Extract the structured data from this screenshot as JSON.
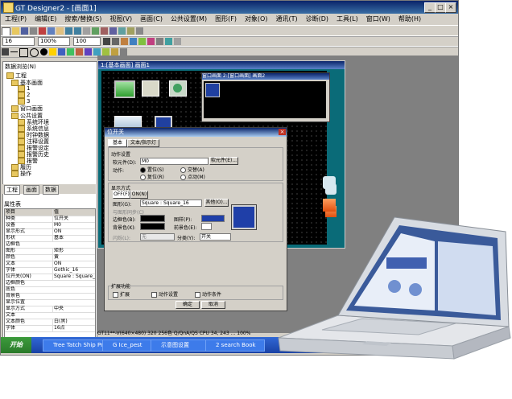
{
  "window": {
    "title": "GT Designer2 - [画面1]"
  },
  "menu": [
    "工程(P)",
    "编辑(E)",
    "搜索/替换(S)",
    "视图(V)",
    "画面(C)",
    "公共设置(M)",
    "图形(F)",
    "对象(O)",
    "通讯(T)",
    "诊断(D)",
    "工具(L)",
    "窗口(W)",
    "帮助(H)"
  ],
  "toolbar": {
    "font_combo": "16",
    "size_combo": "100%",
    "zoom_combo": "100"
  },
  "left_panel": {
    "title": "数据浏览(N)",
    "tree": [
      "工程",
      "基本画面",
      "1",
      "2",
      "3",
      "窗口画面",
      "公共设置",
      "系统环境",
      "系统信息",
      "时钟数据",
      "注释设置",
      "报警设定",
      "报警历史",
      "报警",
      "履历",
      "操作"
    ],
    "tabs": [
      "工程",
      "画面",
      "数据"
    ]
  },
  "properties": {
    "title": "属性表",
    "rows": [
      [
        "项目",
        "值"
      ],
      [
        "种类",
        "位开关"
      ],
      [
        "设备",
        "M0"
      ],
      [
        "显示形式",
        "ON"
      ],
      [
        "形状",
        "基本"
      ],
      [
        "边框色",
        ""
      ],
      [
        "图形",
        "矩形"
      ],
      [
        "颜色",
        "黄"
      ],
      [
        "文本",
        "ON"
      ],
      [
        "字体",
        "Gothic_16"
      ],
      [
        "位开关(ON)",
        "Square : Square_16"
      ],
      [
        "边框颜色",
        ""
      ],
      [
        "底色",
        ""
      ],
      [
        "背景色",
        ""
      ],
      [
        "显示位置",
        ""
      ],
      [
        "显示方式",
        "中央"
      ],
      [
        "文本",
        ""
      ],
      [
        "文本颜色",
        "白(黑)"
      ],
      [
        "字体",
        "16点"
      ]
    ]
  },
  "design_window": {
    "title": "1:[基本画面] 画面1",
    "sub_title": "窗口画面 2:[窗口画面] 画面2"
  },
  "dialog": {
    "title": "位开关",
    "tabs": [
      "基本",
      "文本/指示灯"
    ],
    "section_action": "动作设置",
    "device_label": "软元件(D):",
    "device_value": "M0",
    "device_button": "软元件(E)...",
    "action_label": "动作:",
    "action_options": [
      "置位(S)",
      "复位(R)",
      "交替(A)",
      "点动(M)"
    ],
    "section_display": "显示方式",
    "state_tabs": [
      "OFF(F)",
      "ON(N)"
    ],
    "shape_label": "图形(G):",
    "shape_value": "Square : Square_16",
    "shape_button": "其他(O)...",
    "frame_check": "与图形同步(C)",
    "frame_color_label": "边框色(B):",
    "bg_color_label": "背景色(K):",
    "pattern_label": "图样(P):",
    "fore_color_label": "前景色(E):",
    "blink_label": "闪烁(L):",
    "blink_value": "无",
    "category_label": "分类(Y):",
    "category_value": "开关",
    "section_ext": "扩展功能",
    "ext_options": [
      "扩展",
      "动作设置",
      "动作条件"
    ],
    "ok_label": "确定",
    "cancel_label": "取消"
  },
  "status_bar": {
    "text": "GT11**-V(640×480) 320 256色 Q/QnA/QS CPU 34, 243 ...  100%"
  },
  "taskbar": {
    "start": "开始",
    "tasks": [
      "Tree Tatch Ship Pro",
      "G Ice_pest",
      "示意图设置",
      "2 search Book"
    ]
  },
  "colors": {
    "title_bar": "#0a246a",
    "dialog_frame_swatch": "#1f3fa8",
    "canvas": "#000000",
    "design_window": "#0a6b78"
  }
}
